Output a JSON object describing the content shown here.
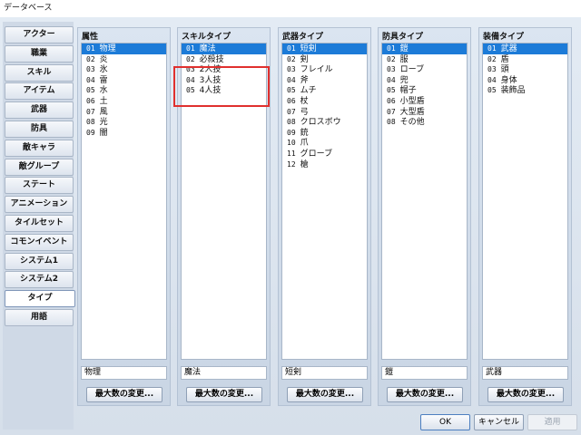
{
  "window": {
    "title": "データベース"
  },
  "tabs": [
    {
      "label": "アクター"
    },
    {
      "label": "職業"
    },
    {
      "label": "スキル"
    },
    {
      "label": "アイテム"
    },
    {
      "label": "武器"
    },
    {
      "label": "防具"
    },
    {
      "label": "敵キャラ"
    },
    {
      "label": "敵グループ"
    },
    {
      "label": "ステート"
    },
    {
      "label": "アニメーション"
    },
    {
      "label": "タイルセット"
    },
    {
      "label": "コモンイベント"
    },
    {
      "label": "システム1"
    },
    {
      "label": "システム2"
    },
    {
      "label": "タイプ",
      "active": true
    },
    {
      "label": "用語"
    }
  ],
  "panels": [
    {
      "title": "属性",
      "items": [
        {
          "num": "01",
          "name": "物理"
        },
        {
          "num": "02",
          "name": "炎"
        },
        {
          "num": "03",
          "name": "氷"
        },
        {
          "num": "04",
          "name": "雷"
        },
        {
          "num": "05",
          "name": "水"
        },
        {
          "num": "06",
          "name": "土"
        },
        {
          "num": "07",
          "name": "風"
        },
        {
          "num": "08",
          "name": "光"
        },
        {
          "num": "09",
          "name": "闇"
        }
      ],
      "selected_index": 0,
      "name_value": "物理",
      "max_button": "最大数の変更..."
    },
    {
      "title": "スキルタイプ",
      "items": [
        {
          "num": "01",
          "name": "魔法"
        },
        {
          "num": "02",
          "name": "必殺技"
        },
        {
          "num": "03",
          "name": "2人技"
        },
        {
          "num": "04",
          "name": "3人技"
        },
        {
          "num": "05",
          "name": "4人技"
        }
      ],
      "selected_index": 0,
      "name_value": "魔法",
      "max_button": "最大数の変更..."
    },
    {
      "title": "武器タイプ",
      "items": [
        {
          "num": "01",
          "name": "短剣"
        },
        {
          "num": "02",
          "name": "剣"
        },
        {
          "num": "03",
          "name": "フレイル"
        },
        {
          "num": "04",
          "name": "斧"
        },
        {
          "num": "05",
          "name": "ムチ"
        },
        {
          "num": "06",
          "name": "杖"
        },
        {
          "num": "07",
          "name": "弓"
        },
        {
          "num": "08",
          "name": "クロスボウ"
        },
        {
          "num": "09",
          "name": "銃"
        },
        {
          "num": "10",
          "name": "爪"
        },
        {
          "num": "11",
          "name": "グローブ"
        },
        {
          "num": "12",
          "name": "槍"
        }
      ],
      "selected_index": 0,
      "name_value": "短剣",
      "max_button": "最大数の変更..."
    },
    {
      "title": "防具タイプ",
      "items": [
        {
          "num": "01",
          "name": "鎧"
        },
        {
          "num": "02",
          "name": "服"
        },
        {
          "num": "03",
          "name": "ローブ"
        },
        {
          "num": "04",
          "name": "兜"
        },
        {
          "num": "05",
          "name": "帽子"
        },
        {
          "num": "06",
          "name": "小型盾"
        },
        {
          "num": "07",
          "name": "大型盾"
        },
        {
          "num": "08",
          "name": "その他"
        }
      ],
      "selected_index": 0,
      "name_value": "鎧",
      "max_button": "最大数の変更..."
    },
    {
      "title": "装備タイプ",
      "items": [
        {
          "num": "01",
          "name": "武器"
        },
        {
          "num": "02",
          "name": "盾"
        },
        {
          "num": "03",
          "name": "頭"
        },
        {
          "num": "04",
          "name": "身体"
        },
        {
          "num": "05",
          "name": "装飾品"
        }
      ],
      "selected_index": 0,
      "name_value": "武器",
      "max_button": "最大数の変更..."
    }
  ],
  "buttons": {
    "ok": "OK",
    "cancel": "キャンセル",
    "apply": "適用"
  },
  "colors": {
    "selection": "#1c7bd8",
    "highlight_box": "#e0302e"
  }
}
